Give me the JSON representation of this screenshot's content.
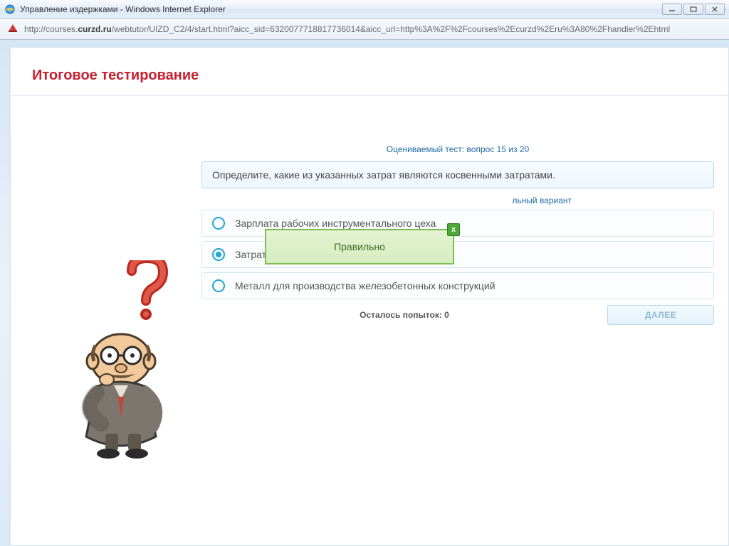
{
  "window": {
    "title": "Управление издержками - Windows Internet Explorer",
    "url_prefix": "http://courses.",
    "url_host": "curzd.ru",
    "url_rest": "/webtutor/UIZD_C2/4/start.html?aicc_sid=6320077718817736014&aicc_url=http%3A%2F%2Fcourses%2Ecurzd%2Eru%3A80%2Fhandler%2Ehtml"
  },
  "page": {
    "heading": "Итоговое тестирование",
    "progress": "Оцениваемый тест: вопрос 15 из 20",
    "question": "Определите, какие из указанных затрат являются косвенными затратами.",
    "hint_partial": "льный вариант",
    "options": [
      {
        "label": "Зарплата рабочих инструментального цеха",
        "checked": false
      },
      {
        "label": "Затраты на доставку сырья и материалов",
        "checked": true
      },
      {
        "label": "Металл для производства железобетонных конструкций",
        "checked": false
      }
    ],
    "attempts": "Осталось попыток: 0",
    "next": "ДАЛЕЕ"
  },
  "feedback": {
    "text": "Правильно",
    "close": "x"
  }
}
